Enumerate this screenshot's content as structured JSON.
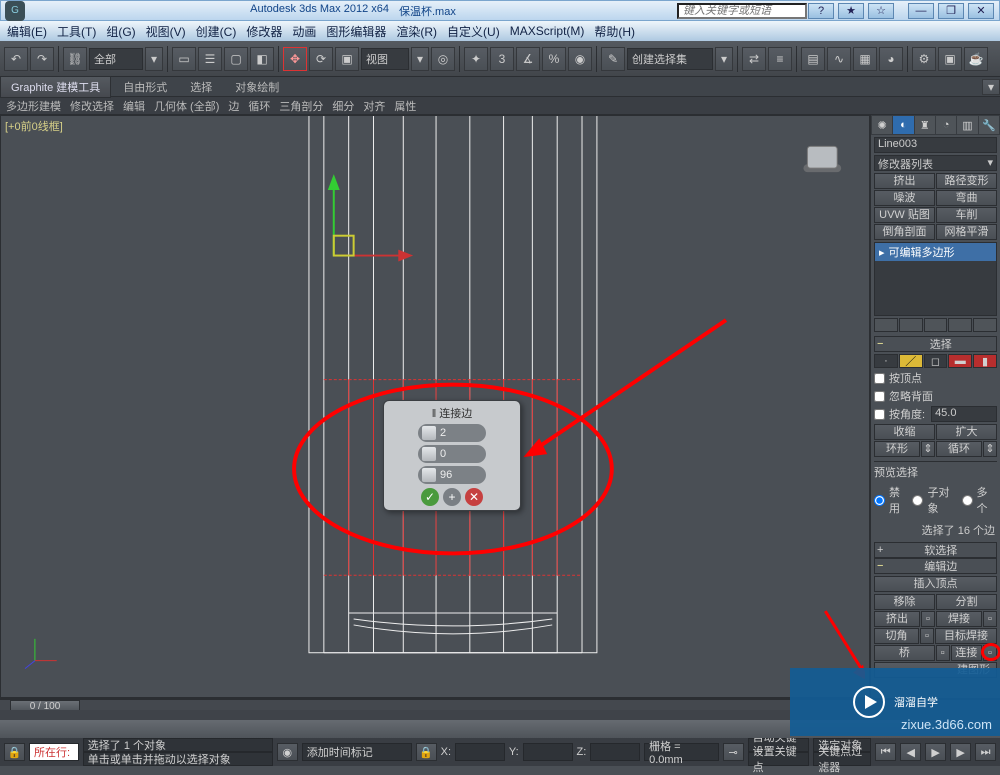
{
  "title": {
    "app": "Autodesk 3ds Max 2012 x64",
    "file": "保温杯.max"
  },
  "searchbox": {
    "placeholder": "键入关键字或短语"
  },
  "menu": [
    "编辑(E)",
    "工具(T)",
    "组(G)",
    "视图(V)",
    "创建(C)",
    "修改器",
    "动画",
    "图形编辑器",
    "渲染(R)",
    "自定义(U)",
    "MAXScript(M)",
    "帮助(H)"
  ],
  "toolbar": {
    "scope_label": "全部",
    "view_label": "视图",
    "selset_label": "创建选择集"
  },
  "ribbon_tabs": [
    "Graphite 建模工具",
    "自由形式",
    "选择",
    "对象绘制"
  ],
  "ribbon2": [
    "多边形建模",
    "修改选择",
    "编辑",
    "几何体 (全部)",
    "边",
    "循环",
    "三角剖分",
    "细分",
    "对齐",
    "属性"
  ],
  "viewport": {
    "label": "[+0前0线框]"
  },
  "popup": {
    "title": "‖ 连接边",
    "v1": "2",
    "v2": "0",
    "v3": "96"
  },
  "panel": {
    "objname": "Line003",
    "modifier_list": "修改器列表",
    "mod_btns": [
      [
        "挤出",
        "路径变形"
      ],
      [
        "噪波",
        "弯曲"
      ],
      [
        "UVW 贴图",
        "车削"
      ],
      [
        "倒角剖面",
        "网格平滑"
      ]
    ],
    "mod_item": "可编辑多边形",
    "rollout_select": "选择",
    "chk_vertex": "按顶点",
    "chk_backface": "忽略背面",
    "chk_angle": "按角度:",
    "angle_val": "45.0",
    "shrink": "收缩",
    "grow": "扩大",
    "ring": "环形",
    "loop": "循环",
    "preview": "预览选择",
    "radio_disable": "禁用",
    "radio_sub": "子对象",
    "radio_multi": "多个",
    "sel_info": "选择了 16 个边",
    "rollout_soft": "软选择",
    "rollout_edge": "编辑边",
    "insert_vert": "插入顶点",
    "remove": "移除",
    "split": "分割",
    "extrude": "挤出",
    "weld": "焊接",
    "chamfer": "切角",
    "target_weld": "目标焊接",
    "connect": "连接",
    "create_shape": "建图形"
  },
  "timeline": {
    "frame": "0 / 100"
  },
  "status": {
    "sel": "选择了 1 个对象",
    "hint": "单击或单击并拖动以选择对象",
    "add_tag": "添加时间标记",
    "x": "X:",
    "y": "Y:",
    "z": "Z:",
    "grid": "栅格 = 0.0mm",
    "autokey": "自动关键点",
    "selset": "选定对象",
    "setkey": "设置关键点",
    "keyfilter": "关键点过滤器",
    "location": "所在行:"
  },
  "branding": {
    "name": "溜溜自学",
    "url": "zixue.3d66.com"
  }
}
